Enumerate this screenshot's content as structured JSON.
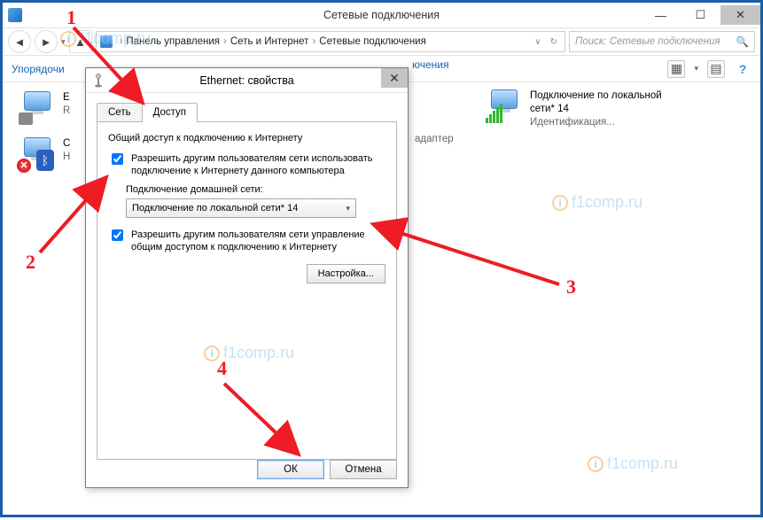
{
  "window": {
    "title": "Сетевые подключения",
    "min": "—",
    "max": "☐",
    "close": "✕"
  },
  "addressbar": {
    "back": "◄",
    "forward": "►",
    "up": "▲",
    "crumb1": "Панель управления",
    "crumb2": "Сеть и Интернет",
    "crumb3": "Сетевые подключения",
    "sep": "›",
    "chevron": "∨",
    "refresh": "↻"
  },
  "search": {
    "placeholder": "Поиск: Сетевые подключения",
    "icon": "🔍"
  },
  "toolbar": {
    "organize": "Упорядочи",
    "connections_cut": "ючения",
    "view_icon": "▦",
    "list_icon": "▤",
    "help_icon": "?"
  },
  "leftItems": [
    {
      "l1": "E",
      "l2": "R"
    },
    {
      "l1": "С",
      "l2": "Н"
    }
  ],
  "adapter_lbl": "адаптер",
  "rightItem": {
    "l1": "Подключение по локальной сети* 14",
    "l2": "Идентификация..."
  },
  "dialog": {
    "title": "Ethernet: свойства",
    "close": "✕",
    "tabs": {
      "net": "Сеть",
      "access": "Доступ"
    },
    "group": "Общий доступ к подключению к Интернету",
    "chk1": "Разрешить другим пользователям сети использовать подключение к Интернету данного компьютера",
    "home_label": "Подключение домашней сети:",
    "combo_value": "Подключение по локальной сети* 14",
    "chk2": "Разрешить другим пользователям сети управление общим доступом к подключению к Интернету",
    "settings": "Настройка...",
    "ok": "ОК",
    "cancel": "Отмена"
  },
  "annotations": {
    "n1": "1",
    "n2": "2",
    "n3": "3",
    "n4": "4"
  },
  "watermark": "f1comp.ru"
}
